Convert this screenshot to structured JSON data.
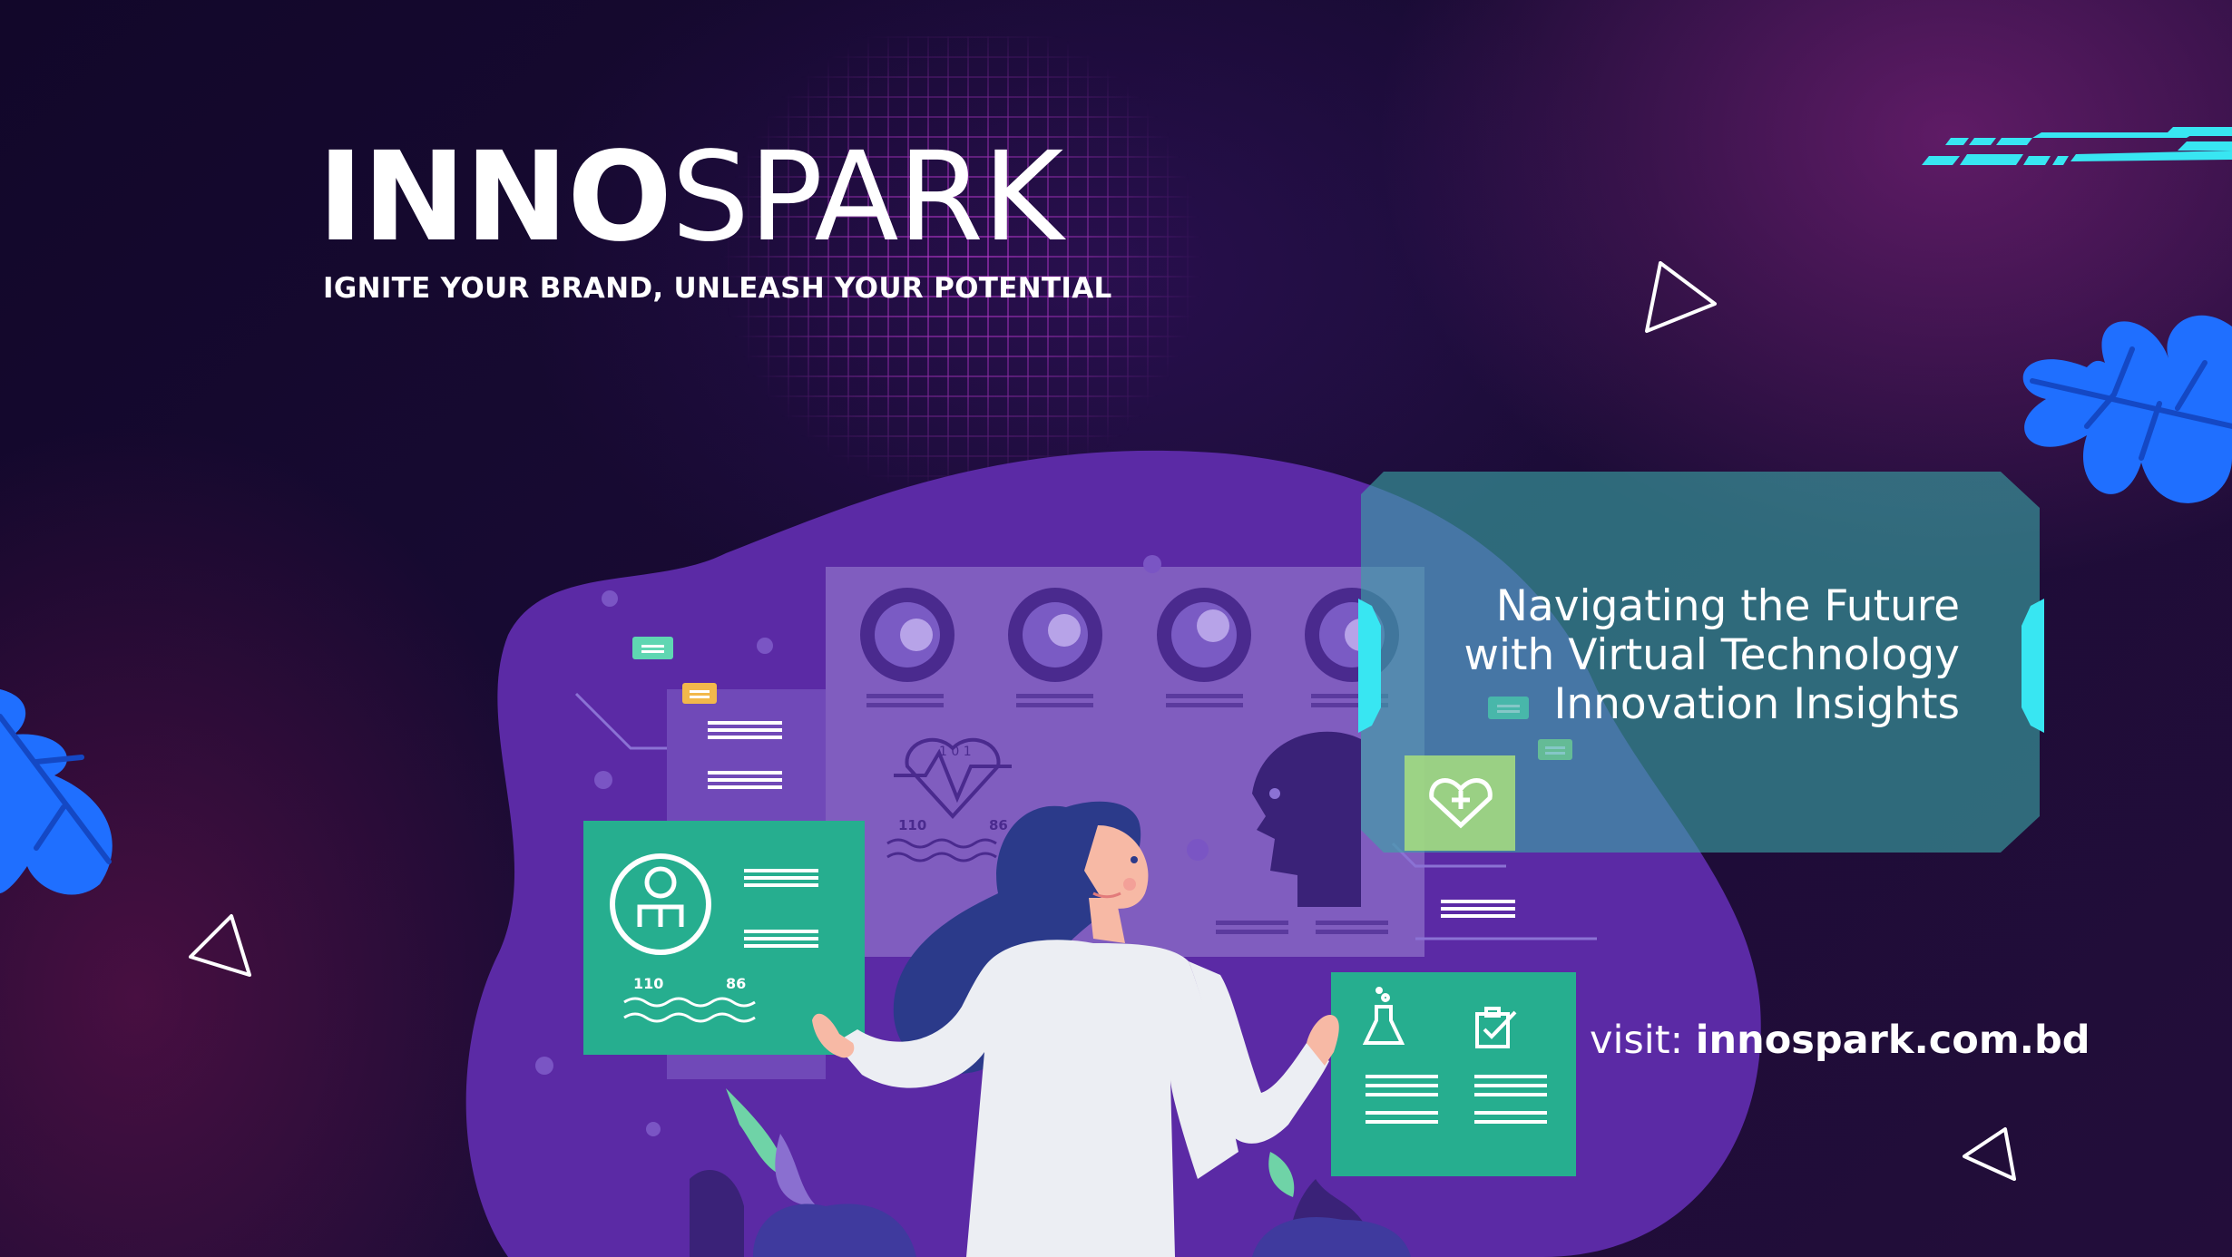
{
  "brand": {
    "name_bold": "INNO",
    "name_light": "SPARK",
    "tagline": "IGNITE YOUR BRAND, UNLEASH YOUR POTENTIAL"
  },
  "headline": {
    "lines": [
      "Navigating the Future",
      "with Virtual Technology",
      "Innovation Insights"
    ]
  },
  "visit": {
    "label": "visit: ",
    "url": "innospark.com.bd"
  },
  "panels": {
    "left_card_numbers": [
      "110",
      "86"
    ],
    "screen_numbers": [
      "110",
      "86"
    ],
    "heart_label": "1 0 1"
  },
  "colors": {
    "background": "#140a2e",
    "blob": "#5b2aa5",
    "card_green": "#26ae8f",
    "card_teal": "#2f7c86",
    "leaf_blue": "#1f6fff",
    "accent_cyan": "#38e6f2"
  },
  "icons": [
    "user-badge-icon",
    "flask-icon",
    "clipboard-check-icon",
    "heart-plus-icon",
    "heart-rate-icon",
    "leaf-icon",
    "triangle-icon"
  ]
}
